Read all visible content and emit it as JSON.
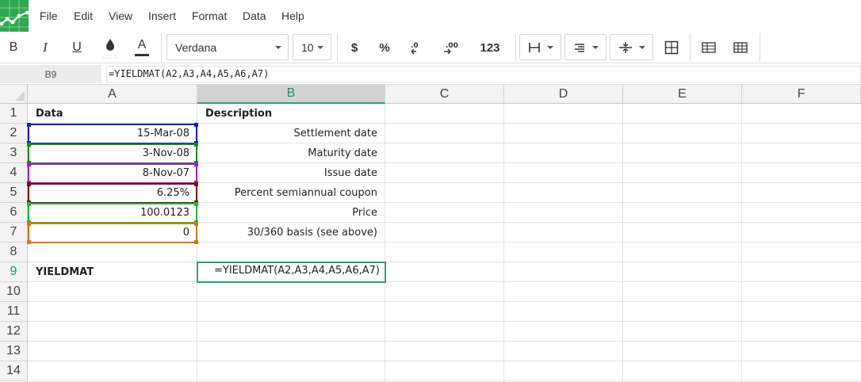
{
  "menu": [
    "File",
    "Edit",
    "View",
    "Insert",
    "Format",
    "Data",
    "Help"
  ],
  "toolbar": {
    "bold": "B",
    "italic": "I",
    "underline": "U",
    "text_color": "A",
    "font": "Verdana",
    "font_size": "10",
    "currency": "$",
    "percent": "%",
    "decrease_decimals": ".0",
    "increase_decimals": ".00",
    "number_format": "123"
  },
  "formula_bar": {
    "cell_ref": "B9",
    "formula": "=YIELDMAT(A2,A3,A4,A5,A6,A7)"
  },
  "columns": [
    "A",
    "B",
    "C",
    "D",
    "E",
    "F"
  ],
  "active_column": "B",
  "rows": [
    "1",
    "2",
    "3",
    "4",
    "5",
    "6",
    "7",
    "8",
    "9",
    "10",
    "11",
    "12",
    "13",
    "14"
  ],
  "active_row": "9",
  "cells": {
    "A1": "Data",
    "B1": "Description",
    "A2": "15-Mar-08",
    "B2": "Settlement date",
    "A3": "3-Nov-08",
    "B3": "Maturity date",
    "A4": "8-Nov-07",
    "B4": "Issue date",
    "A5": "6.25%",
    "B5": "Percent semiannual coupon",
    "A6": "100.0123",
    "B6": "Price",
    "A7": "0",
    "B7": "30/360 basis (see above)",
    "A9": "YIELDMAT",
    "B9": "=YIELDMAT(A2,A3,A4,A5,A6,A7)"
  },
  "colors": {
    "brand": "#2fa84f",
    "selection": "#2fa07b",
    "ref_A2": "#1a1acc",
    "ref_A3": "#178a17",
    "ref_A4": "#9b22c9",
    "ref_A5": "#7a0e16",
    "ref_A6": "#20b83a",
    "ref_A7": "#d2771c"
  }
}
